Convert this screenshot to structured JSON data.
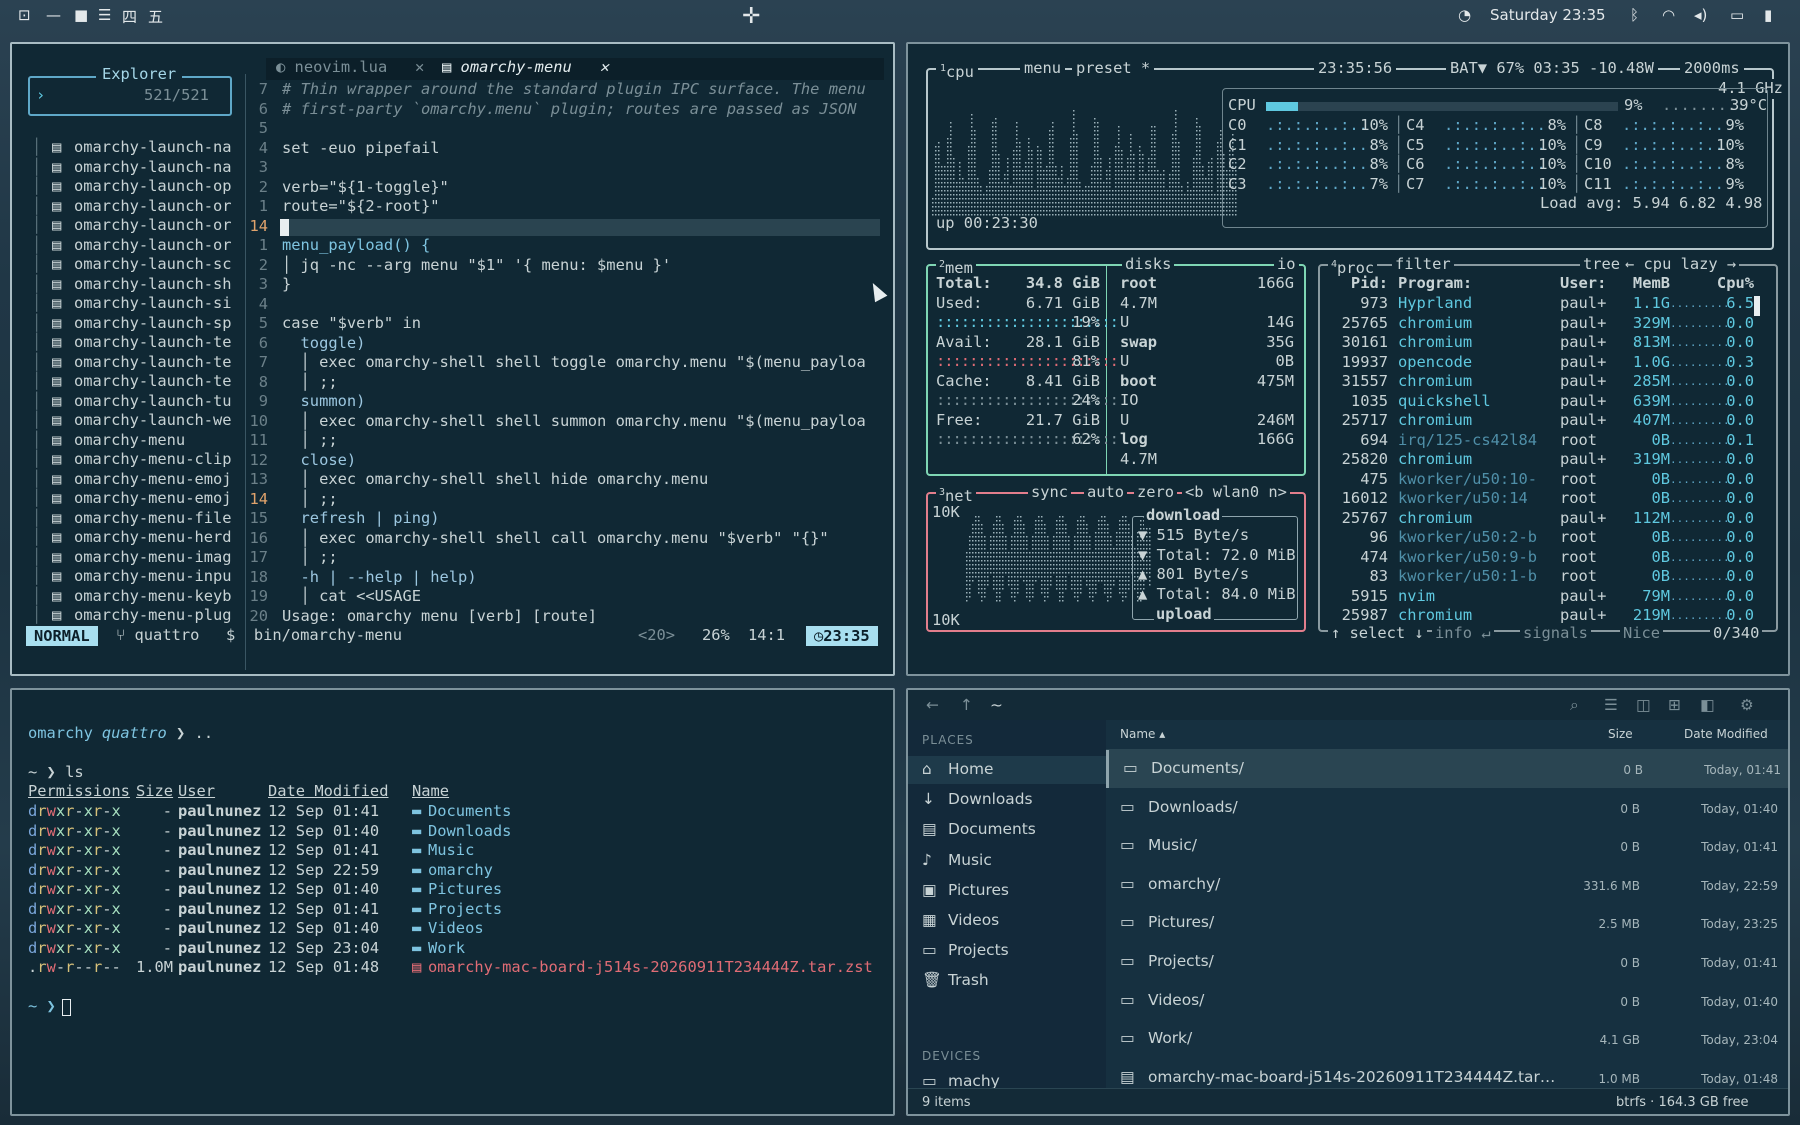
{
  "waybar": {
    "workspaces": [
      "一",
      "二",
      "三",
      "四",
      "五"
    ],
    "clock": "Saturday 23:35",
    "icons": [
      "grid-icon",
      "minus-icon",
      "square-icon",
      "menu-icon",
      "bluetooth-icon",
      "wifi-icon",
      "volume-icon",
      "monitor-icon",
      "battery-icon"
    ]
  },
  "nvim": {
    "tabs": [
      {
        "label": "neovim.lua",
        "active": false
      },
      {
        "label": "omarchy-menu",
        "active": true
      }
    ],
    "explorer_title": "Explorer",
    "explorer_count": "521/521",
    "files": [
      "omarchy-launch-na",
      "omarchy-launch-na",
      "omarchy-launch-op",
      "omarchy-launch-or",
      "omarchy-launch-or",
      "omarchy-launch-or",
      "omarchy-launch-sc",
      "omarchy-launch-sh",
      "omarchy-launch-si",
      "omarchy-launch-sp",
      "omarchy-launch-te",
      "omarchy-launch-te",
      "omarchy-launch-te",
      "omarchy-launch-tu",
      "omarchy-launch-we",
      "omarchy-menu",
      "omarchy-menu-clip",
      "omarchy-menu-emoj",
      "omarchy-menu-emoj",
      "omarchy-menu-file",
      "omarchy-menu-herd",
      "omarchy-menu-imag",
      "omarchy-menu-inpu",
      "omarchy-menu-keyb",
      "omarchy-menu-plug"
    ],
    "selected_file_index": 15,
    "line_numbers": [
      "7",
      "6",
      "5",
      "4",
      "3",
      "2",
      "1",
      "14",
      "1",
      "2",
      "3",
      "4",
      "5",
      "6",
      "7",
      "8",
      "9",
      "10",
      "11",
      "12",
      "13",
      "14",
      "15",
      "16",
      "17",
      "18",
      "19",
      "20"
    ],
    "code": [
      "# Thin wrapper around the standard plugin IPC surface. The menu",
      "# first-party `omarchy.menu` plugin; routes are passed as JSON",
      "",
      "set -euo pipefail",
      "",
      "verb=\"${1-toggle}\"",
      "route=\"${2-root}\"",
      "",
      "menu_payload() {",
      "│ jq -nc --arg menu \"$1\" '{ menu: $menu }'",
      "}",
      "",
      "case \"$verb\" in",
      "  toggle)",
      "  │ exec omarchy-shell shell toggle omarchy.menu \"$(menu_payloa",
      "  │ ;;",
      "  summon)",
      "  │ exec omarchy-shell shell summon omarchy.menu \"$(menu_payloa",
      "  │ ;;",
      "  close)",
      "  │ exec omarchy-shell shell hide omarchy.menu",
      "  │ ;;",
      "  refresh | ping)",
      "  │ exec omarchy-shell shell call omarchy.menu \"$verb\" \"{}\"",
      "  │ ;;",
      "  -h | --help | help)",
      "  │ cat <<USAGE",
      "Usage: omarchy menu [verb] [route]"
    ],
    "status": {
      "mode": "NORMAL",
      "branch": "quattro",
      "path": "bin/omarchy-menu",
      "count": "<20>",
      "percent": "26%",
      "position": "14:1",
      "time": "23:35"
    }
  },
  "btop": {
    "cpu_header": {
      "cpu": "cpu",
      "menu": "menu",
      "preset": "preset *",
      "time": "23:35:56",
      "battery": "BAT▼ 67% 03:35 -10.48W",
      "interval": "2000ms",
      "ghz": "4.1 GHz"
    },
    "cpu_total": {
      "label": "CPU",
      "pct": "9%",
      "temp": "39°C",
      "fill": 0.09
    },
    "cores": [
      [
        "C0",
        "10%"
      ],
      [
        "C1",
        "8%"
      ],
      [
        "C2",
        "8%"
      ],
      [
        "C3",
        "7%"
      ],
      [
        "C4",
        "8%"
      ],
      [
        "C5",
        "10%"
      ],
      [
        "C6",
        "10%"
      ],
      [
        "C7",
        "10%"
      ],
      [
        "C8",
        "9%"
      ],
      [
        "C9",
        "10%"
      ],
      [
        "C10",
        "8%"
      ],
      [
        "C11",
        "9%"
      ]
    ],
    "load_avg": "Load avg: 5.94 6.82 4.98",
    "uptime": "up 00:23:30",
    "mem": {
      "title": "mem",
      "total_label": "Total:",
      "total": "34.8 GiB",
      "used_label": "Used:",
      "used": "6.71 GiB",
      "used_pct": "19%",
      "avail_label": "Avail:",
      "avail": "28.1 GiB",
      "avail_pct": "81%",
      "cache_label": "Cache:",
      "cache": "8.41 GiB",
      "cache_pct": "24%",
      "free_label": "Free:",
      "free": "21.7 GiB",
      "free_pct": "62%"
    },
    "disks": {
      "title": "disks",
      "io": "io",
      "root": "root",
      "root_size": "166G",
      "root_val": "4.7M",
      "u1": "U",
      "u1_val": "14G",
      "swap": "swap",
      "swap_size": "35G",
      "u2": "U",
      "u2_val": "0B",
      "boot": "boot",
      "boot_size": "475M",
      "io_label": "IO",
      "u3": "U",
      "u3_val": "246M",
      "log": "log",
      "log_size": "166G",
      "log_val": "4.7M"
    },
    "net": {
      "title": "net",
      "sync": "sync",
      "auto": "auto",
      "zero": "zero",
      "iface": "<b wlan0 n>",
      "top": "10K",
      "bottom": "10K",
      "download": "download",
      "dl_rate": "▼ 515 Byte/s",
      "dl_total": "▼ Total: 72.0 MiB",
      "ul_rate": "▲ 801 Byte/s",
      "ul_total": "▲ Total: 84.0 MiB",
      "upload": "upload"
    },
    "proc": {
      "title": "proc",
      "filter": "filter",
      "tree": "tree",
      "sort": "← cpu lazy →",
      "cols": [
        "Pid:",
        "Program:",
        "User:",
        "MemB",
        "Cpu%"
      ],
      "rows": [
        [
          "973",
          "Hyprland",
          "paul+",
          "1.1G",
          "6.5"
        ],
        [
          "25765",
          "chromium",
          "paul+",
          "329M",
          "0.0"
        ],
        [
          "30161",
          "chromium",
          "paul+",
          "813M",
          "0.0"
        ],
        [
          "19937",
          "opencode",
          "paul+",
          "1.0G",
          "0.3"
        ],
        [
          "31557",
          "chromium",
          "paul+",
          "285M",
          "0.0"
        ],
        [
          "1035",
          "quickshell",
          "paul+",
          "639M",
          "0.0"
        ],
        [
          "25717",
          "chromium",
          "paul+",
          "407M",
          "0.0"
        ],
        [
          "694",
          "irq/125-cs42l84",
          "root",
          "0B",
          "0.1"
        ],
        [
          "25820",
          "chromium",
          "paul+",
          "319M",
          "0.0"
        ],
        [
          "475",
          "kworker/u50:10-",
          "root",
          "0B",
          "0.0"
        ],
        [
          "16012",
          "kworker/u50:14",
          "root",
          "0B",
          "0.0"
        ],
        [
          "25767",
          "chromium",
          "paul+",
          "112M",
          "0.0"
        ],
        [
          "96",
          "kworker/u50:2-b",
          "root",
          "0B",
          "0.0"
        ],
        [
          "474",
          "kworker/u50:9-b",
          "root",
          "0B",
          "0.0"
        ],
        [
          "83",
          "kworker/u50:1-b",
          "root",
          "0B",
          "0.0"
        ],
        [
          "5915",
          "nvim",
          "paul+",
          "79M",
          "0.0"
        ],
        [
          "25987",
          "chromium",
          "paul+",
          "219M",
          "0.0"
        ]
      ],
      "footer": {
        "select": "↑ select ↓",
        "info": "info ↵",
        "signals": "signals",
        "nice": "Nice",
        "count": "0/340"
      }
    }
  },
  "term": {
    "prompt1": "omarchy",
    "branch": "quattro",
    "cmd1": " ❯ ..",
    "prompt2": "~ ❯ ls",
    "headers": [
      "Permissions",
      "Size",
      "User",
      "Date Modified",
      "Name"
    ],
    "rows": [
      [
        "drwxr-xr-x",
        "-",
        "paulnunez",
        "12 Sep 01:41",
        "Documents"
      ],
      [
        "drwxr-xr-x",
        "-",
        "paulnunez",
        "12 Sep 01:40",
        "Downloads"
      ],
      [
        "drwxr-xr-x",
        "-",
        "paulnunez",
        "12 Sep 01:41",
        "Music"
      ],
      [
        "drwxr-xr-x",
        "-",
        "paulnunez",
        "12 Sep 22:59",
        "omarchy"
      ],
      [
        "drwxr-xr-x",
        "-",
        "paulnunez",
        "12 Sep 01:40",
        "Pictures"
      ],
      [
        "drwxr-xr-x",
        "-",
        "paulnunez",
        "12 Sep 01:41",
        "Projects"
      ],
      [
        "drwxr-xr-x",
        "-",
        "paulnunez",
        "12 Sep 01:40",
        "Videos"
      ],
      [
        "drwxr-xr-x",
        "-",
        "paulnunez",
        "12 Sep 23:04",
        "Work"
      ],
      [
        ".rw-r--r--",
        "1.0M",
        "paulnunez",
        "12 Sep 01:48",
        "omarchy-mac-board-j514s-20260911T234444Z.tar.zst"
      ]
    ],
    "prompt3": "~ ❯ "
  },
  "fm": {
    "path": "~",
    "places_label": "PLACES",
    "places": [
      "Home",
      "Downloads",
      "Documents",
      "Music",
      "Pictures",
      "Videos",
      "Projects",
      "Trash"
    ],
    "devices_label": "DEVICES",
    "devices": [
      "machy"
    ],
    "cols": {
      "name": "Name ▴",
      "size": "Size",
      "date": "Date Modified"
    },
    "rows": [
      [
        "Documents/",
        "0 B",
        "Today, 01:41"
      ],
      [
        "Downloads/",
        "0 B",
        "Today, 01:40"
      ],
      [
        "Music/",
        "0 B",
        "Today, 01:41"
      ],
      [
        "omarchy/",
        "331.6 MB",
        "Today, 22:59"
      ],
      [
        "Pictures/",
        "2.5 MB",
        "Today, 23:25"
      ],
      [
        "Projects/",
        "0 B",
        "Today, 01:41"
      ],
      [
        "Videos/",
        "0 B",
        "Today, 01:40"
      ],
      [
        "Work/",
        "4.1 GB",
        "Today, 23:04"
      ],
      [
        "omarchy-mac-board-j514s-20260911T234444Z.tar…",
        "1.0 MB",
        "Today, 01:48"
      ]
    ],
    "status_left": "9 items",
    "status_right": "btrfs · 164.3 GB free"
  }
}
